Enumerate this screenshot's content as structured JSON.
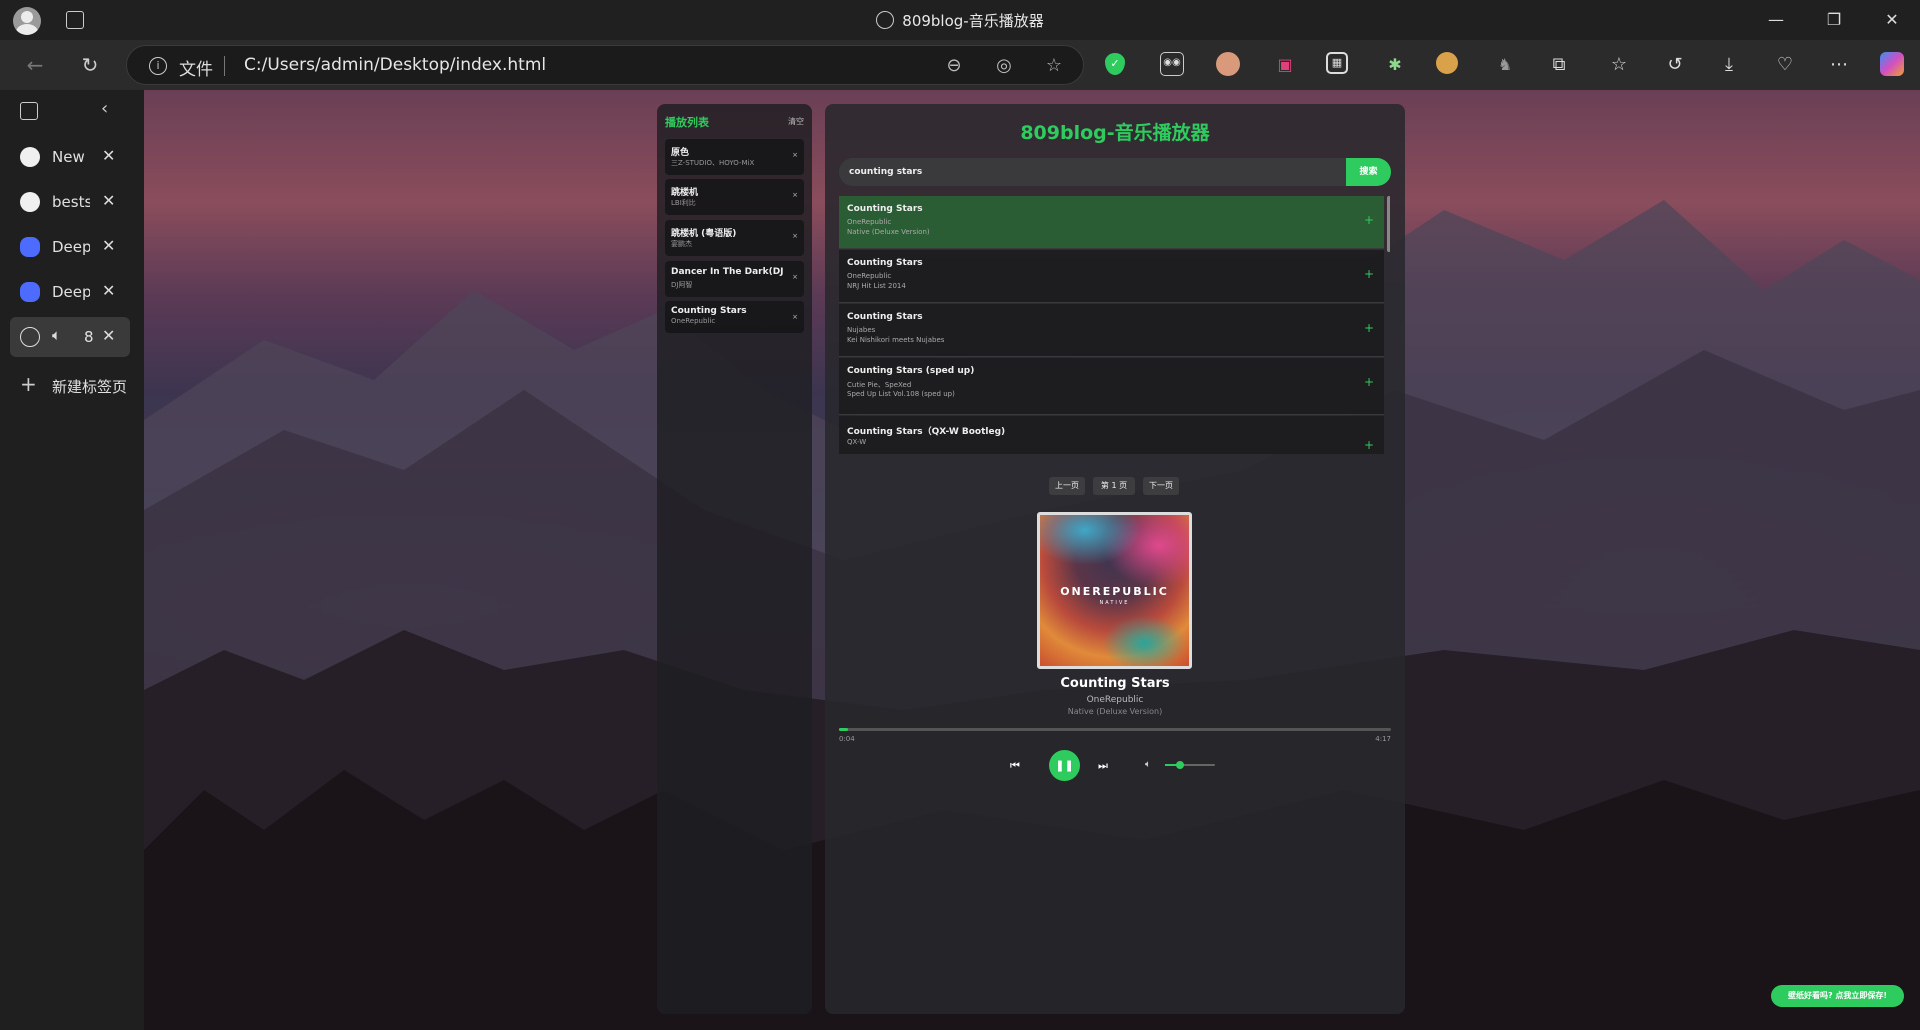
{
  "browser": {
    "window_title": "809blog-音乐播放器",
    "address_scheme": "文件",
    "address_url": "C:/Users/admin/Desktop/index.html",
    "tabs": [
      {
        "label": "New F",
        "icon": "github-icon"
      },
      {
        "label": "bestst",
        "icon": "github-icon"
      },
      {
        "label": "DeepS",
        "icon": "deepseek-icon"
      },
      {
        "label": "DeepS",
        "icon": "deepseek-icon"
      },
      {
        "label": "8",
        "icon": "globe-icon",
        "active": true
      }
    ],
    "new_tab_label": "新建标签页"
  },
  "player": {
    "title": "809blog-音乐播放器",
    "playlist": {
      "title": "播放列表",
      "clear_label": "清空",
      "items": [
        {
          "title": "原色",
          "artist": "三Z-STUDIO、HOYO-MiX"
        },
        {
          "title": "跳楼机",
          "artist": "LBI利比"
        },
        {
          "title": "跳楼机 (粤语版)",
          "artist": "宴鹏杰"
        },
        {
          "title": "Dancer In The Dark(DJ...",
          "artist": "DJ阿智"
        },
        {
          "title": "Counting Stars",
          "artist": "OneRepublic"
        }
      ]
    },
    "search": {
      "value": "counting stars",
      "button_label": "搜索"
    },
    "results": [
      {
        "title": "Counting Stars",
        "artist": "OneRepublic",
        "album": "Native (Deluxe Version)",
        "selected": true
      },
      {
        "title": "Counting Stars",
        "artist": "OneRepublic",
        "album": "NRJ Hit List 2014"
      },
      {
        "title": "Counting Stars",
        "artist": "Nujabes",
        "album": "Kei Nishikori meets Nujabes"
      },
      {
        "title": "Counting Stars (sped up)",
        "artist": "Cutie Pie、SpeXed",
        "album": "Sped Up List Vol.108 (sped up)"
      },
      {
        "title": "Counting Stars（QX-W Bootleg)",
        "artist": "QX-W",
        "album": ""
      }
    ],
    "pager": {
      "prev": "上一页",
      "page": "第 1 页",
      "next": "下一页"
    },
    "cover": {
      "band": "ONEREPUBLIC",
      "sub": "NATIVE"
    },
    "now_playing": {
      "title": "Counting Stars",
      "artist": "OneRepublic",
      "album": "Native (Deluxe Version)",
      "current_time": "0:04",
      "total_time": "4:17",
      "progress": 0.016,
      "volume": 0.3
    },
    "toast": "壁纸好看吗? 点我立即保存!"
  },
  "colors": {
    "accent": "#2ecc5e"
  }
}
